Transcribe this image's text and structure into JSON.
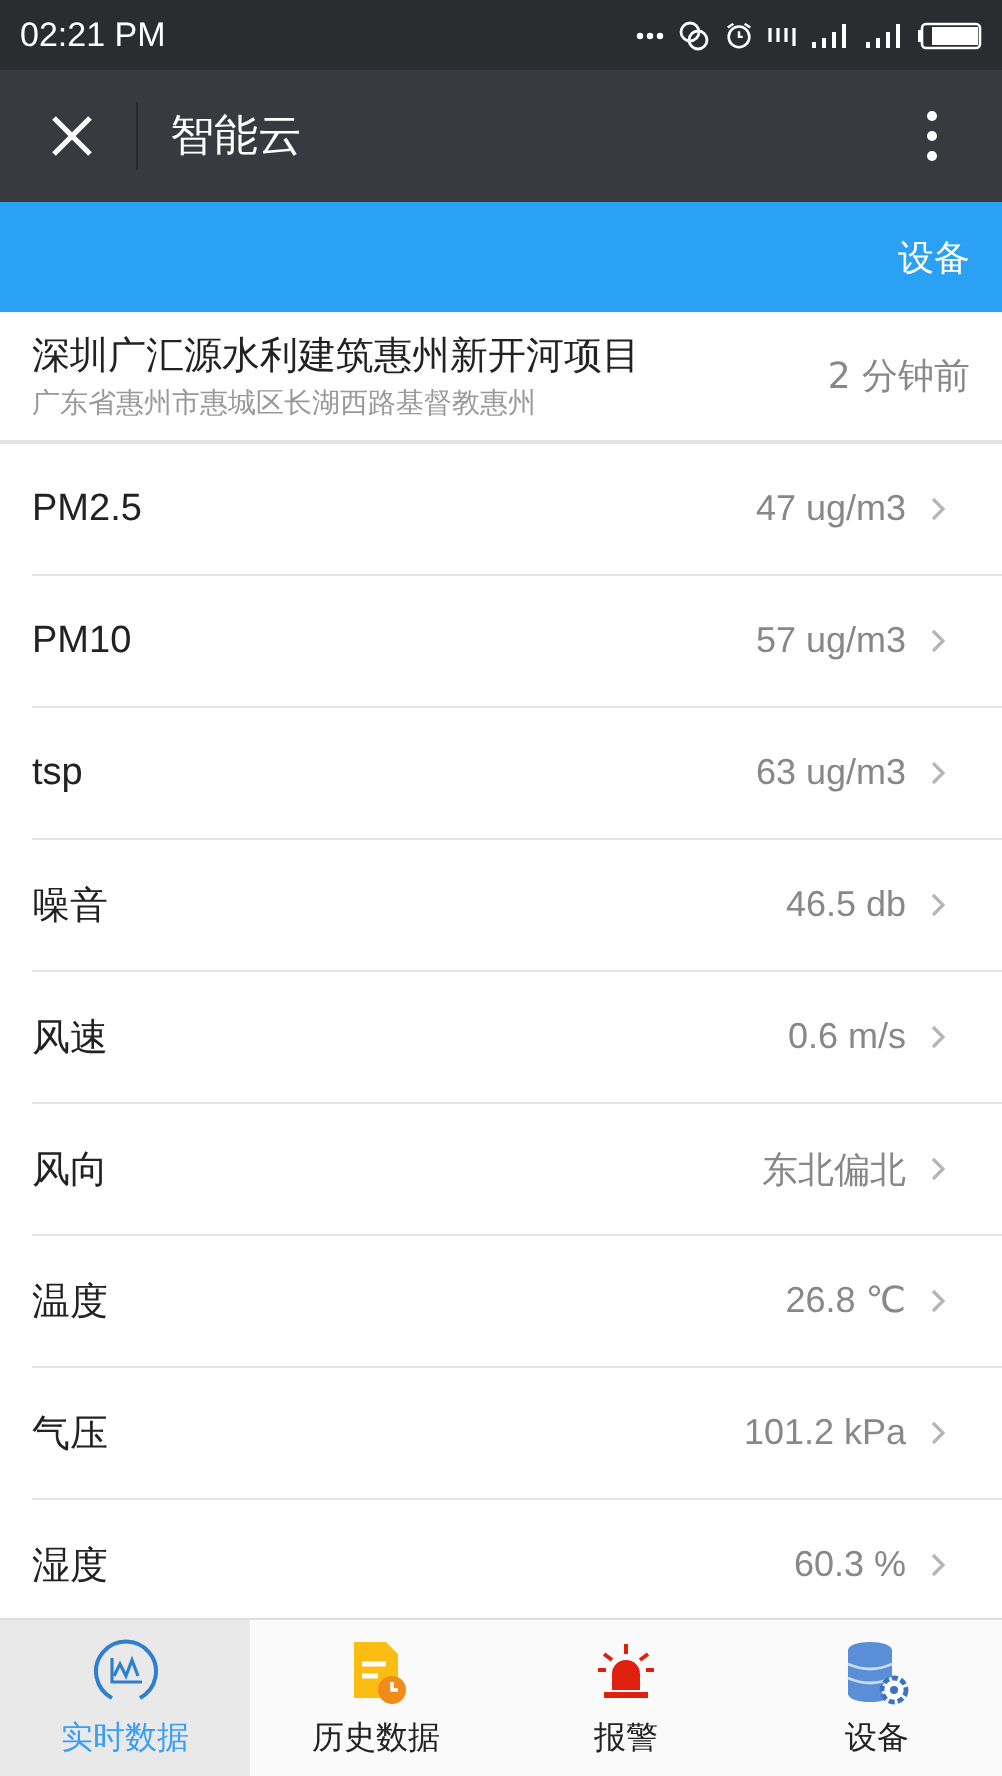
{
  "status_bar": {
    "time": "02:21 PM"
  },
  "app_bar": {
    "title": "智能云"
  },
  "blue_bar": {
    "action": "设备"
  },
  "project": {
    "name": "深圳广汇源水利建筑惠州新开河项目",
    "address": "广东省惠州市惠城区长湖西路基督教惠州",
    "updated": "2 分钟前"
  },
  "readings": [
    {
      "label": "PM2.5",
      "value": "47 ug/m3"
    },
    {
      "label": "PM10",
      "value": "57 ug/m3"
    },
    {
      "label": "tsp",
      "value": "63 ug/m3"
    },
    {
      "label": "噪音",
      "value": "46.5 db"
    },
    {
      "label": "风速",
      "value": "0.6 m/s"
    },
    {
      "label": "风向",
      "value": "东北偏北"
    },
    {
      "label": "温度",
      "value": "26.8 ℃"
    },
    {
      "label": "气压",
      "value": "101.2 kPa"
    },
    {
      "label": "湿度",
      "value": "60.3 %"
    }
  ],
  "tabs": [
    {
      "label": "实时数据",
      "kind": "chart",
      "selected": true
    },
    {
      "label": "历史数据",
      "kind": "history",
      "selected": false
    },
    {
      "label": "报警",
      "kind": "alarm",
      "selected": false
    },
    {
      "label": "设备",
      "kind": "device",
      "selected": false
    }
  ]
}
